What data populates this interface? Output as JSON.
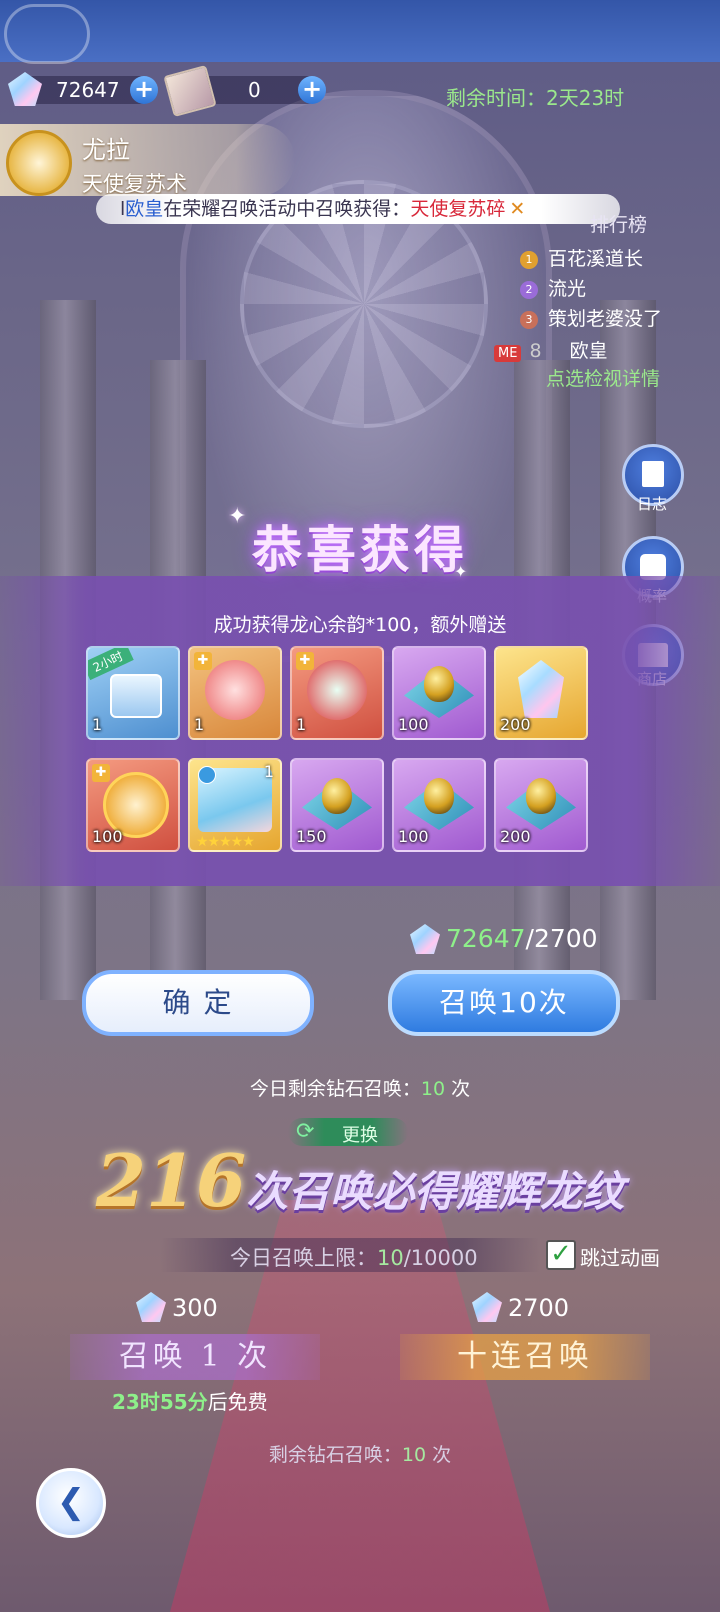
{
  "header": {
    "diamonds": "72647",
    "tickets": "0",
    "remaining_time": "剩余时间：2天23时"
  },
  "character": {
    "name": "尤拉",
    "title": "天使复苏术"
  },
  "ticker": {
    "player": "欧皇",
    "middle": "在荣耀召唤活动中召唤获得：",
    "item": "天使复苏碎",
    "lead": "l",
    "close": "✕"
  },
  "ranking": {
    "title": "排行榜",
    "entries": [
      {
        "rank": "1",
        "name": "百花溪道长"
      },
      {
        "rank": "2",
        "name": "流光"
      },
      {
        "rank": "3",
        "name": "策划老婆没了"
      }
    ],
    "me_label": "ME",
    "me_rank": "8",
    "me_name": "欧皇",
    "detail_link": "点选检视详情"
  },
  "side_buttons": {
    "log": "日志",
    "probability": "概率",
    "shop": "商店"
  },
  "reward": {
    "title": "恭喜获得",
    "subtitle": "成功获得龙心余韵*100，额外赠送",
    "badge": "2小时",
    "items": [
      {
        "qty": "1"
      },
      {
        "qty": "1"
      },
      {
        "qty": "1"
      },
      {
        "qty": "100"
      },
      {
        "qty": "200"
      },
      {
        "qty": "100"
      },
      {
        "qty": "1"
      },
      {
        "qty": "150"
      },
      {
        "qty": "100"
      },
      {
        "qty": "200"
      }
    ]
  },
  "cost": {
    "have": "72647",
    "need": "/2700"
  },
  "buttons": {
    "confirm": "确 定",
    "summon10": "召唤10次"
  },
  "today_remaining": {
    "prefix": "今日剩余钻石召唤：",
    "count": "10",
    "suffix": "次"
  },
  "refresh": "更换",
  "pity": {
    "number": "216",
    "text": "次召唤必得耀辉龙纹"
  },
  "limit": {
    "prefix": "今日召唤上限：",
    "used": "10",
    "total": "/10000"
  },
  "skip_animation": "跳过动画",
  "single": {
    "cost": "300",
    "label": "召唤 1 次",
    "free_time": "23时55分",
    "free_suffix": "后免费"
  },
  "ten": {
    "cost": "2700",
    "label": "十连召唤"
  },
  "bottom_remaining": {
    "prefix": "剩余钻石召唤：",
    "count": "10",
    "suffix": "次"
  },
  "colors": {
    "accent_blue": "#2f7be0",
    "highlight_green": "#8ef08a",
    "ticker_red": "#d8283a",
    "panel_purple": "#7850af"
  }
}
